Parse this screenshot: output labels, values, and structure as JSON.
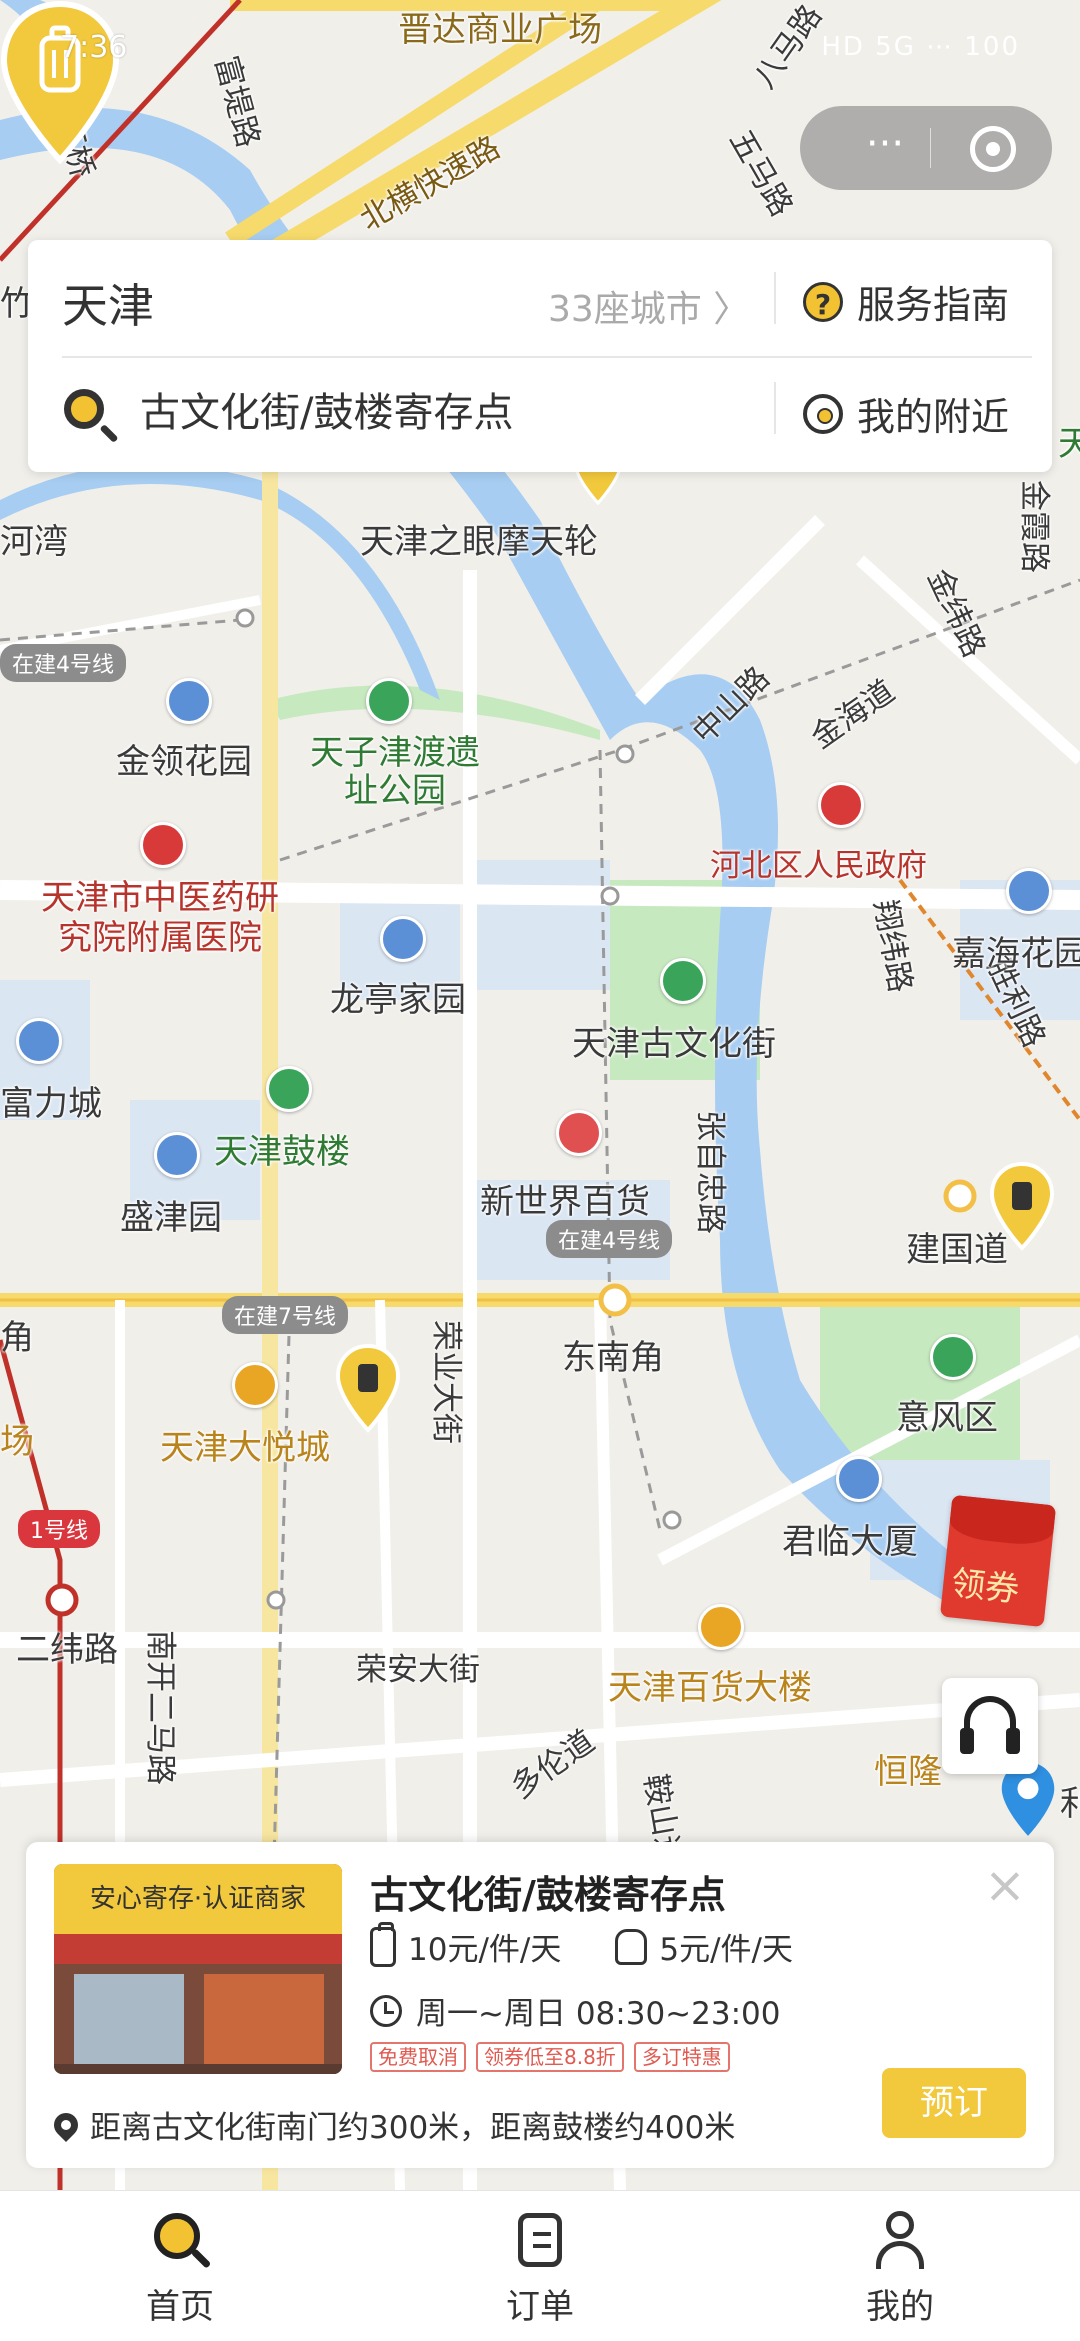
{
  "status_bar": {
    "time": "7:36",
    "right": "HD 5G ⋯ 100"
  },
  "capsule": {
    "more": "···"
  },
  "header": {
    "city": "天津",
    "city_count": "33座城市 〉",
    "guide": "服务指南",
    "search_text": "古文化街/鼓楼寄存点",
    "nearby": "我的附近"
  },
  "map": {
    "roads": [
      "晋达商业广场",
      "北横快速路",
      "新红桥",
      "富堤路",
      "八马路",
      "五马路",
      "金霞路",
      "金纬路",
      "中山路",
      "金海道",
      "河北区人民政府",
      "翔纬路",
      "胜利路",
      "张自忠路",
      "荣业大街",
      "南开二马路",
      "荣安大街",
      "多伦道",
      "鞍山道",
      "二纬路"
    ],
    "places": [
      "天津之眼摩天轮",
      "金领花园",
      "天子津渡遗址公园",
      "天津市中医药研究院附属医院",
      "嘉海花园",
      "龙亭家园",
      "天津古文化街",
      "富力城",
      "天津鼓楼",
      "盛津园",
      "新世界百货",
      "建国道",
      "东南角",
      "意风区",
      "天津大悦城",
      "君临大厦",
      "天津百货大楼",
      "恒隆",
      "在建4号线",
      "在建7号线",
      "1号线",
      "河湾",
      "角",
      "场",
      "利",
      "天",
      "竹"
    ],
    "coupon": "领券",
    "colors": {
      "water": "#a7cdf2",
      "park": "#c7e9c0",
      "major_road": "#f6da6b",
      "pin": "#f2c83c"
    }
  },
  "store": {
    "badge": "安心寄存·认证商家",
    "name": "古文化街/鼓楼寄存点",
    "price_case": "10元/件/天",
    "price_bag": "5元/件/天",
    "hours": "周一~周日 08:30~23:00",
    "tags": [
      "免费取消",
      "领券低至8.8折",
      "多订特惠"
    ],
    "address": "距离古文化街南门约300米，距离鼓楼约400米",
    "book": "预订",
    "close": "×"
  },
  "tabs": [
    {
      "label": "首页",
      "icon": "home-search-icon"
    },
    {
      "label": "订单",
      "icon": "orders-icon"
    },
    {
      "label": "我的",
      "icon": "profile-icon"
    }
  ]
}
